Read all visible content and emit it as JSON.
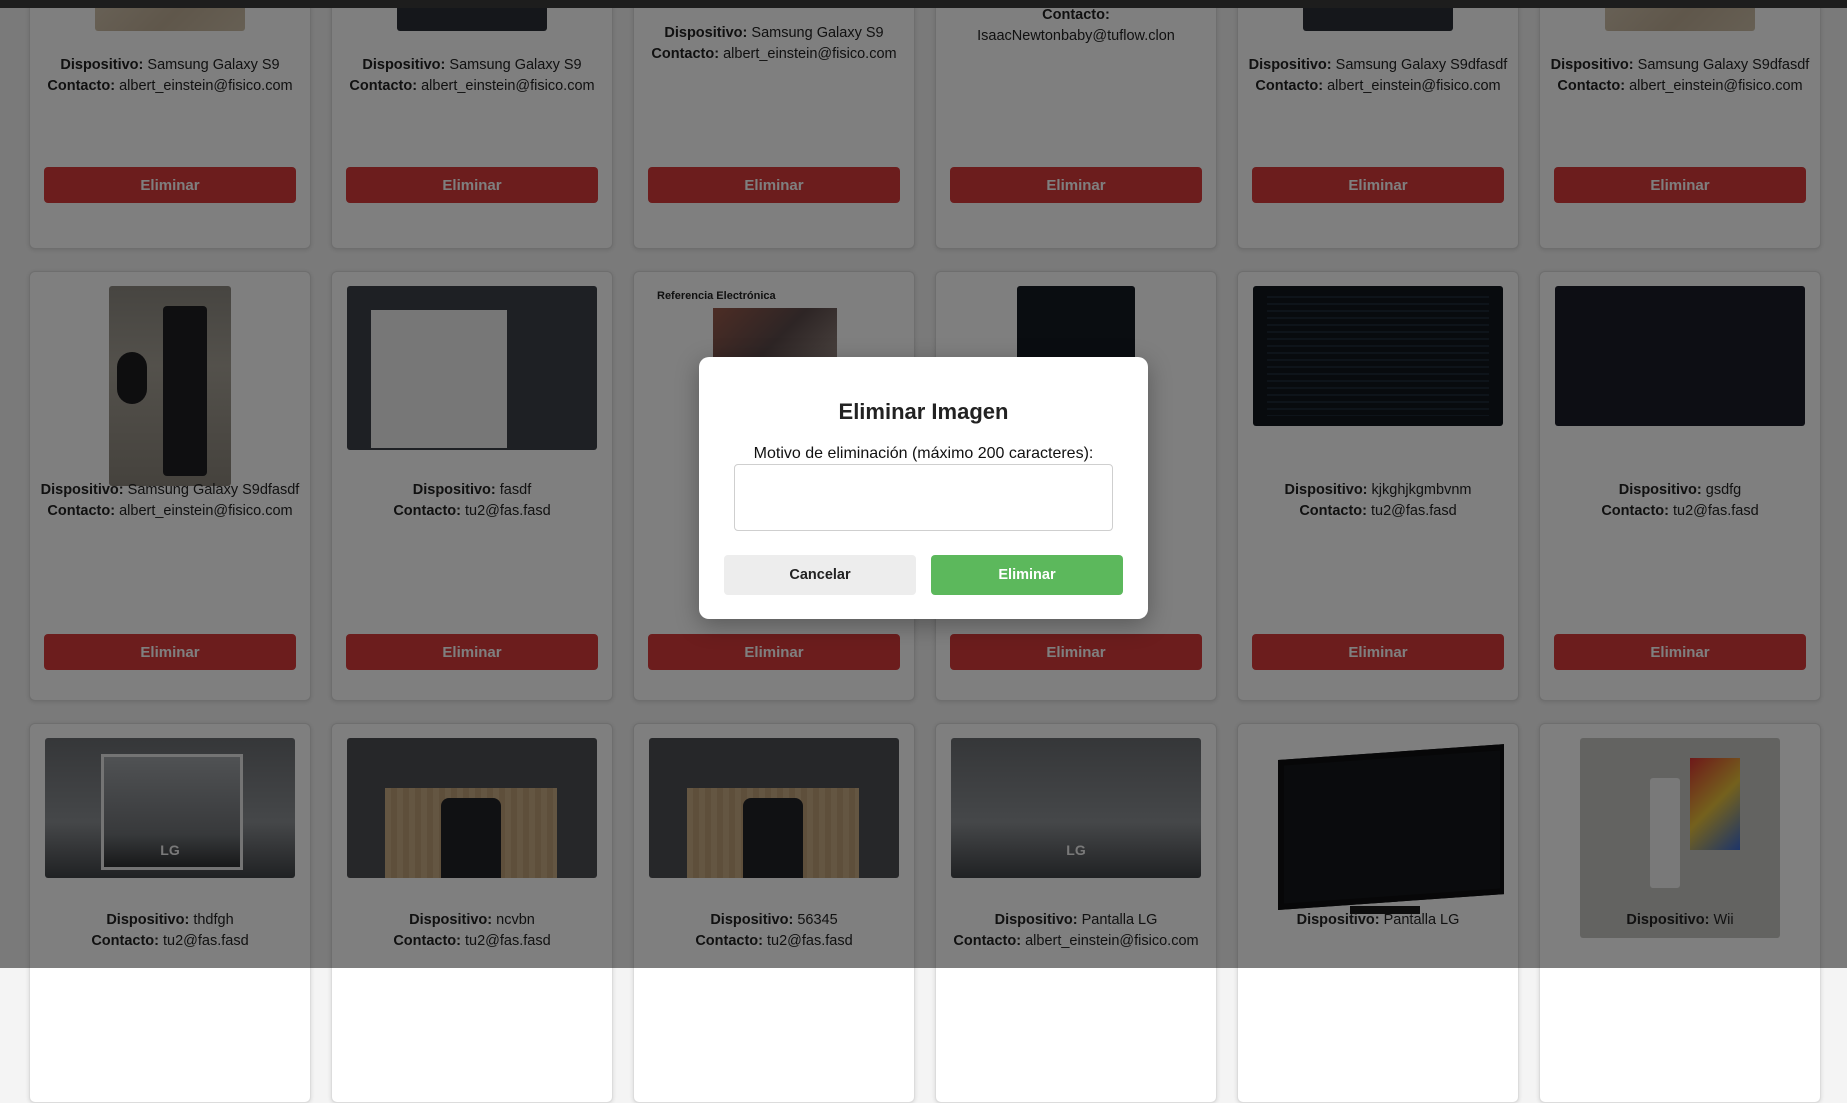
{
  "labels": {
    "device": "Dispositivo:",
    "contact": "Contacto:",
    "delete": "Eliminar"
  },
  "cards": [
    {
      "device": "Samsung Galaxy S9",
      "contact": "albert_einstein@fisico.com",
      "thumb": "beige"
    },
    {
      "device": "Samsung Galaxy S9",
      "contact": "albert_einstein@fisico.com",
      "thumb": "phone"
    },
    {
      "device": "Samsung Galaxy S9",
      "contact": "albert_einstein@fisico.com",
      "thumb": "none"
    },
    {
      "device": "",
      "contact": "IsaacNewtonbaby@tuflow.clon",
      "thumb": "none"
    },
    {
      "device": "Samsung Galaxy S9dfasdf",
      "contact": "albert_einstein@fisico.com",
      "thumb": "phone"
    },
    {
      "device": "Samsung Galaxy S9dfasdf",
      "contact": "albert_einstein@fisico.com",
      "thumb": "beige"
    },
    {
      "device": "Samsung Galaxy S9dfasdf",
      "contact": "albert_einstein@fisico.com",
      "thumb": "keyboard"
    },
    {
      "device": "fasdf",
      "contact": "tu2@fas.fasd",
      "thumb": "wheel"
    },
    {
      "device": "",
      "contact": "",
      "thumb": "doc",
      "thumb_text": "Referencia Electrónica"
    },
    {
      "device": "",
      "contact": "",
      "thumb": "dark"
    },
    {
      "device": "kjkghjkgmbvnm",
      "contact": "tu2@fas.fasd",
      "thumb": "code"
    },
    {
      "device": "gsdfg",
      "contact": "tu2@fas.fasd",
      "thumb": "night"
    },
    {
      "device": "thdfgh",
      "contact": "tu2@fas.fasd",
      "thumb": "lg",
      "thumb_text": "LG"
    },
    {
      "device": "ncvbn",
      "contact": "tu2@fas.fasd",
      "thumb": "wood"
    },
    {
      "device": "56345",
      "contact": "tu2@fas.fasd",
      "thumb": "wood"
    },
    {
      "device": "Pantalla LG",
      "contact": "albert_einstein@fisico.com",
      "thumb": "lgfull",
      "thumb_text": "LG"
    },
    {
      "device": "Pantalla LG",
      "contact": "",
      "thumb": "tv"
    },
    {
      "device": "Wii",
      "contact": "",
      "thumb": "wii"
    }
  ],
  "modal": {
    "title": "Eliminar Imagen",
    "label": "Motivo de eliminación (máximo 200 caracteres):",
    "reason_value": "",
    "cancel_label": "Cancelar",
    "confirm_label": "Eliminar"
  },
  "colors": {
    "delete": "#d93a3a",
    "confirm": "#5cb85c",
    "overlay": "rgba(0,0,0,0.5)"
  }
}
